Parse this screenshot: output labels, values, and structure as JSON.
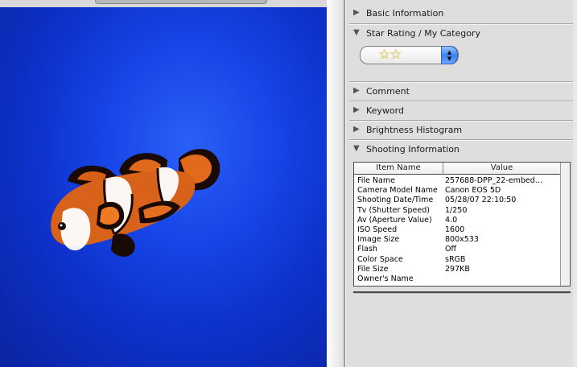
{
  "colors": {
    "photo_water": "#1846e8",
    "panel_bg": "#dedede",
    "star": "#f6e25a"
  },
  "sections": {
    "basic_info": {
      "label": "Basic Information",
      "expanded": false
    },
    "star_rating": {
      "label": "Star Rating / My Category",
      "expanded": true,
      "stars_display": "☆☆",
      "star_count": 2
    },
    "comment": {
      "label": "Comment",
      "expanded": false
    },
    "keyword": {
      "label": "Keyword",
      "expanded": false
    },
    "brightness_histogram": {
      "label": "Brightness Histogram",
      "expanded": false
    },
    "shooting_info": {
      "label": "Shooting Information",
      "expanded": true
    }
  },
  "icons": {
    "collapsed": "triangle-right-icon",
    "expanded": "triangle-down-icon",
    "stepper": "up-down-arrows-icon"
  },
  "table": {
    "columns": [
      "Item Name",
      "Value"
    ],
    "rows": [
      {
        "name": "File Name",
        "value": "257688-DPP_22-embed…"
      },
      {
        "name": "Camera Model Name",
        "value": "Canon EOS 5D"
      },
      {
        "name": "Shooting Date/Time",
        "value": "05/28/07 22:10:50"
      },
      {
        "name": "Tv (Shutter Speed)",
        "value": "1/250"
      },
      {
        "name": "Av (Aperture Value)",
        "value": "4.0"
      },
      {
        "name": "ISO Speed",
        "value": "1600"
      },
      {
        "name": "Image Size",
        "value": "800x533"
      },
      {
        "name": "Flash",
        "value": "Off"
      },
      {
        "name": "Color Space",
        "value": "sRGB"
      },
      {
        "name": "File Size",
        "value": "297KB"
      },
      {
        "name": "Owner's Name",
        "value": ""
      }
    ]
  }
}
